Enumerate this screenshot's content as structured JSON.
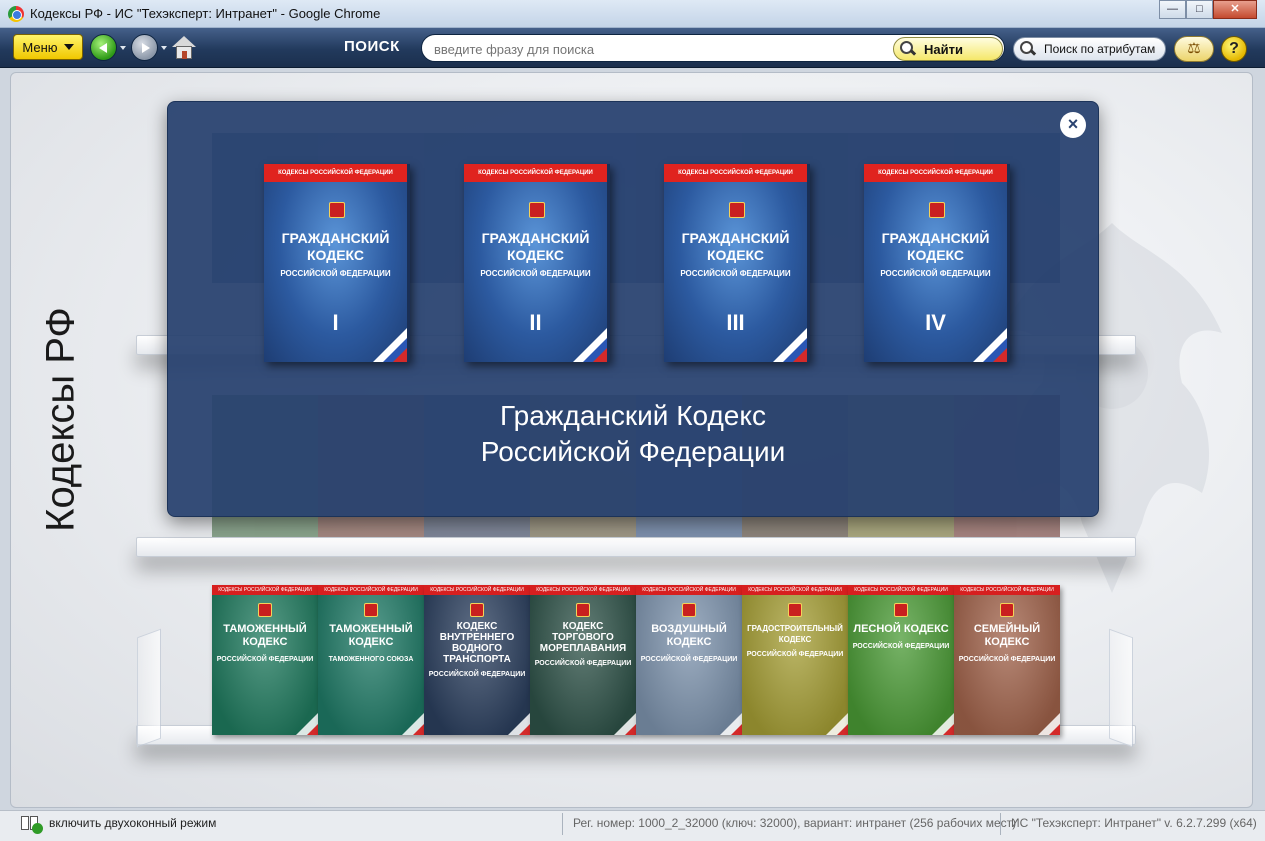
{
  "window": {
    "title": "Кодексы РФ - ИС \"Техэксперт: Интранет\" - Google Chrome",
    "minimize": "—",
    "maximize": "□",
    "close": "✕"
  },
  "toolbar": {
    "menu_label": "Меню",
    "search_label": "ПОИСК",
    "search_placeholder": "введите фразу для поиска",
    "find_label": "Найти",
    "attr_search_label": "Поиск по атрибутам",
    "scales_icon": "⚖",
    "help_label": "?"
  },
  "page": {
    "side_title": "Кодексы РФ"
  },
  "modal": {
    "close_label": "×",
    "caption_line1": "Гражданский Кодекс",
    "caption_line2": "Российской Федерации",
    "volumes": [
      {
        "header": "КОДЕКСЫ РОССИЙСКОЙ ФЕДЕРАЦИИ",
        "title": "ГРАЖДАНСКИЙ КОДЕКС",
        "subtitle": "РОССИЙСКОЙ ФЕДЕРАЦИИ",
        "number": "I"
      },
      {
        "header": "КОДЕКСЫ РОССИЙСКОЙ ФЕДЕРАЦИИ",
        "title": "ГРАЖДАНСКИЙ КОДЕКС",
        "subtitle": "РОССИЙСКОЙ ФЕДЕРАЦИИ",
        "number": "II"
      },
      {
        "header": "КОДЕКСЫ РОССИЙСКОЙ ФЕДЕРАЦИИ",
        "title": "ГРАЖДАНСКИЙ КОДЕКС",
        "subtitle": "РОССИЙСКОЙ ФЕДЕРАЦИИ",
        "number": "III"
      },
      {
        "header": "КОДЕКСЫ РОССИЙСКОЙ ФЕДЕРАЦИИ",
        "title": "ГРАЖДАНСКИЙ КОДЕКС",
        "subtitle": "РОССИЙСКОЙ ФЕДЕРАЦИИ",
        "number": "IV"
      }
    ]
  },
  "shelf_books": [
    {
      "header": "КОДЕКСЫ РОССИЙСКОЙ ФЕДЕРАЦИИ",
      "title": "ТАМОЖЕННЫЙ КОДЕКС",
      "subtitle": "РОССИЙСКОЙ ФЕДЕРАЦИИ",
      "color": "#1f7a5e"
    },
    {
      "header": "КОДЕКСЫ РОССИЙСКОЙ ФЕДЕРАЦИИ",
      "title": "ТАМОЖЕННЫЙ КОДЕКС",
      "subtitle": "ТАМОЖЕННОГО СОЮЗА",
      "color": "#1f7a66"
    },
    {
      "header": "КОДЕКСЫ РОССИЙСКОЙ ФЕДЕРАЦИИ",
      "title": "КОДЕКС ВНУТРЕННЕГО ВОДНОГО ТРАНСПОРТА",
      "subtitle": "РОССИЙСКОЙ ФЕДЕРАЦИИ",
      "color": "#2b3f5e"
    },
    {
      "header": "КОДЕКСЫ РОССИЙСКОЙ ФЕДЕРАЦИИ",
      "title": "КОДЕКС ТОРГОВОГО МОРЕПЛАВАНИЯ",
      "subtitle": "РОССИЙСКОЙ ФЕДЕРАЦИИ",
      "color": "#2e5248"
    },
    {
      "header": "КОДЕКСЫ РОССИЙСКОЙ ФЕДЕРАЦИИ",
      "title": "ВОЗДУШНЫЙ КОДЕКС",
      "subtitle": "РОССИЙСКОЙ ФЕДЕРАЦИИ",
      "color": "#7d93ad"
    },
    {
      "header": "КОДЕКСЫ РОССИЙСКОЙ ФЕДЕРАЦИИ",
      "title": "ГРАДОСТРОИТЕЛЬНЫЙ КОДЕКС",
      "subtitle": "РОССИЙСКОЙ ФЕДЕРАЦИИ",
      "color": "#a59e35"
    },
    {
      "header": "КОДЕКСЫ РОССИЙСКОЙ ФЕДЕРАЦИИ",
      "title": "ЛЕСНОЙ КОДЕКС",
      "subtitle": "РОССИЙСКОЙ ФЕДЕРАЦИИ",
      "color": "#4a9a35"
    },
    {
      "header": "КОДЕКСЫ РОССИЙСКОЙ ФЕДЕРАЦИИ",
      "title": "СЕМЕЙНЫЙ КОДЕКС",
      "subtitle": "РОССИЙСКОЙ ФЕДЕРАЦИИ",
      "color": "#a0624a"
    }
  ],
  "statusbar": {
    "dual_mode_label": "включить двухоконный режим",
    "reg_info": "Рег. номер: 1000_2_32000 (ключ: 32000), вариант: интранет (256 рабочих мест)",
    "version": "ИС \"Техэксперт: Интранет\" v. 6.2.7.299 (x64)"
  },
  "colors": {
    "modal_bg": "#26406e",
    "toolbar_bg": "#223a5d",
    "accent_yellow": "#f0c700",
    "book_header_red": "#d71f1f"
  }
}
